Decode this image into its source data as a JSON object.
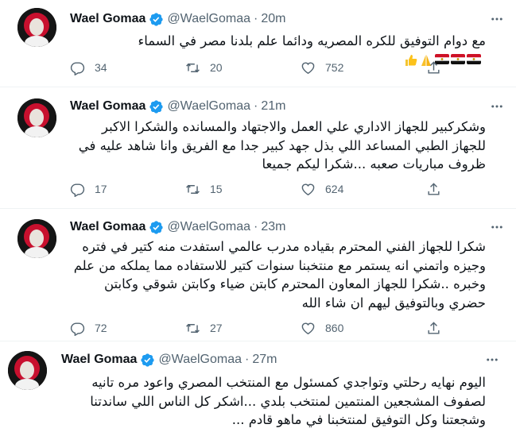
{
  "tweets": [
    {
      "name": "Wael Gomaa",
      "handle": "@WaelGomaa",
      "dot": "·",
      "time": "20m",
      "text": "مع دوام التوفيق للكره المصريه ودائما علم بلدنا مصر في السماء",
      "emojis": [
        "flag-egypt",
        "flag-egypt",
        "flag-egypt",
        "folded-hands",
        "thumbs-up"
      ],
      "replies": "34",
      "retweets": "20",
      "likes": "752"
    },
    {
      "name": "Wael Gomaa",
      "handle": "@WaelGomaa",
      "dot": "·",
      "time": "21m",
      "text": "وشكركبير للجهاز الاداري علي العمل والاجتهاد والمسانده والشكرا الاكبر للجهاز الطبي المساعد اللي بذل جهد كبير  جدا مع الفريق وانا شاهد عليه في ظروف مباريات صعبه ...شكرا ليكم جميعا",
      "replies": "17",
      "retweets": "15",
      "likes": "624"
    },
    {
      "name": "Wael Gomaa",
      "handle": "@WaelGomaa",
      "dot": "·",
      "time": "23m",
      "text": "شكرا للجهاز الفني المحترم بقياده مدرب عالمي استفدت منه كتير في فتره وجيزه واتمني انه يستمر مع منتخبنا سنوات كتير للاستفاده مما يملكه من علم وخبره ..شكرا للجهاز المعاون المحترم كابتن ضياء وكابتن شوقي وكابتن حضري وبالتوفيق ليهم ان شاء الله",
      "replies": "72",
      "retweets": "27",
      "likes": "860"
    },
    {
      "name": "Wael Gomaa",
      "handle": "@WaelGomaa",
      "dot": "·",
      "time": "27m",
      "text": "اليوم نهايه رحلتي وتواجدي كمسئول مع المنتخب المصري واعود مره تانيه لصفوف المشجعين المنتمين لمنتخب بلدي ...اشكر كل الناس اللي ساندتنا وشجعتنا وكل التوفيق لمنتخبنا في ماهو قادم ..."
    }
  ],
  "colors": {
    "text": "#0f1419",
    "secondary": "#536471",
    "verified": "#1d9bf0",
    "divider": "#eff3f4"
  },
  "icons": {
    "verified": "verified-badge-icon",
    "more": "more-options-icon",
    "reply": "reply-icon",
    "retweet": "retweet-icon",
    "like": "like-icon",
    "share": "share-icon"
  }
}
